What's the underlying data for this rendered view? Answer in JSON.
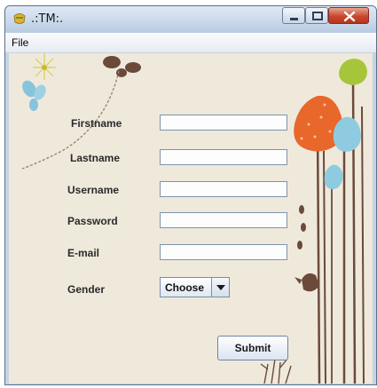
{
  "window": {
    "title": ".:TM:.",
    "controls": {
      "minimize": "minimize",
      "maximize": "maximize",
      "close": "close"
    }
  },
  "menu": {
    "file": "File"
  },
  "form": {
    "firstname_label": "Firstname",
    "lastname_label": "Lastname",
    "username_label": "Username",
    "password_label": "Password",
    "email_label": "E-mail",
    "gender_label": "Gender",
    "firstname_value": "",
    "lastname_value": "",
    "username_value": "",
    "password_value": "",
    "email_value": "",
    "gender_selected": "Choose",
    "submit_label": "Submit"
  },
  "colors": {
    "background": "#efe9dc",
    "tree_orange": "#e8672a",
    "tree_blue": "#8fcbe0",
    "tree_green": "#a7c53a",
    "trunk": "#6b4a3a"
  }
}
